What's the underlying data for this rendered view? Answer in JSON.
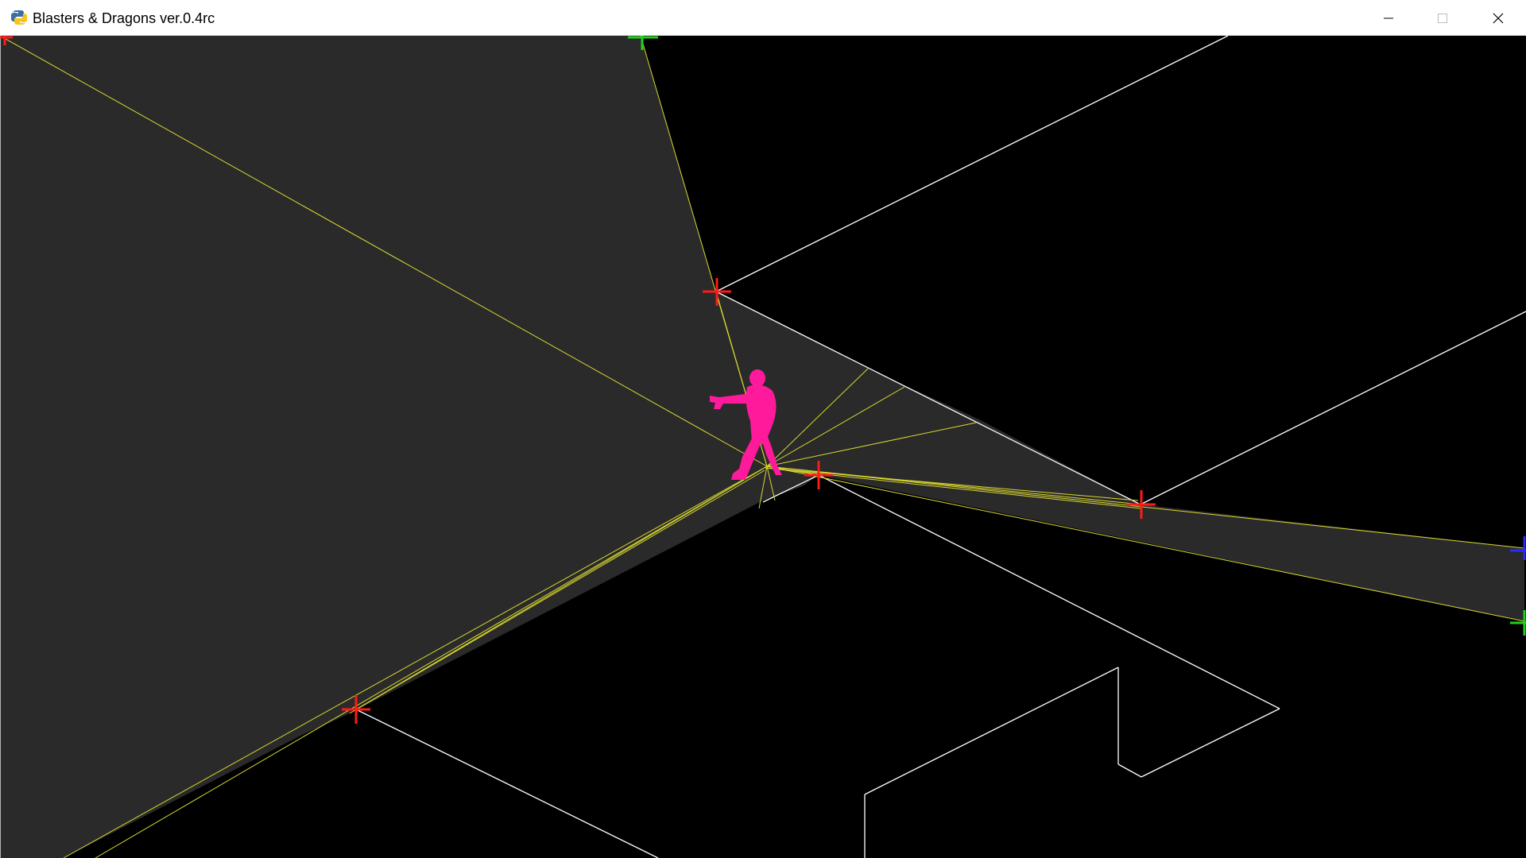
{
  "window": {
    "title": "Blasters & Dragons ver.0.4rc",
    "app_icon": "python-snake-icon",
    "controls": {
      "minimize_icon": "minimize-icon",
      "maximize_icon": "maximize-icon",
      "close_icon": "close-icon"
    }
  },
  "scene": {
    "background_color": "#000000",
    "lit_area_color": "#2a2a2a",
    "wall_color": "#ffffff",
    "ray_color": "#d8d830",
    "player_color": "#ff1a9c",
    "marker_colors": {
      "red": "#ff1a1a",
      "green": "#1fd11f",
      "blue": "#2a2aff"
    },
    "player": {
      "icon": "player-character-icon",
      "pose": "aiming"
    },
    "markers": [
      {
        "name": "vertex-marker-top",
        "color": "red"
      },
      {
        "name": "vertex-marker-center",
        "color": "red"
      },
      {
        "name": "vertex-marker-right",
        "color": "red"
      },
      {
        "name": "vertex-marker-bottom-left",
        "color": "red"
      },
      {
        "name": "edge-marker-top",
        "color": "green"
      },
      {
        "name": "edge-marker-right-lower",
        "color": "green"
      },
      {
        "name": "edge-marker-right-upper",
        "color": "blue"
      },
      {
        "name": "edge-marker-top-left",
        "color": "red"
      }
    ]
  }
}
